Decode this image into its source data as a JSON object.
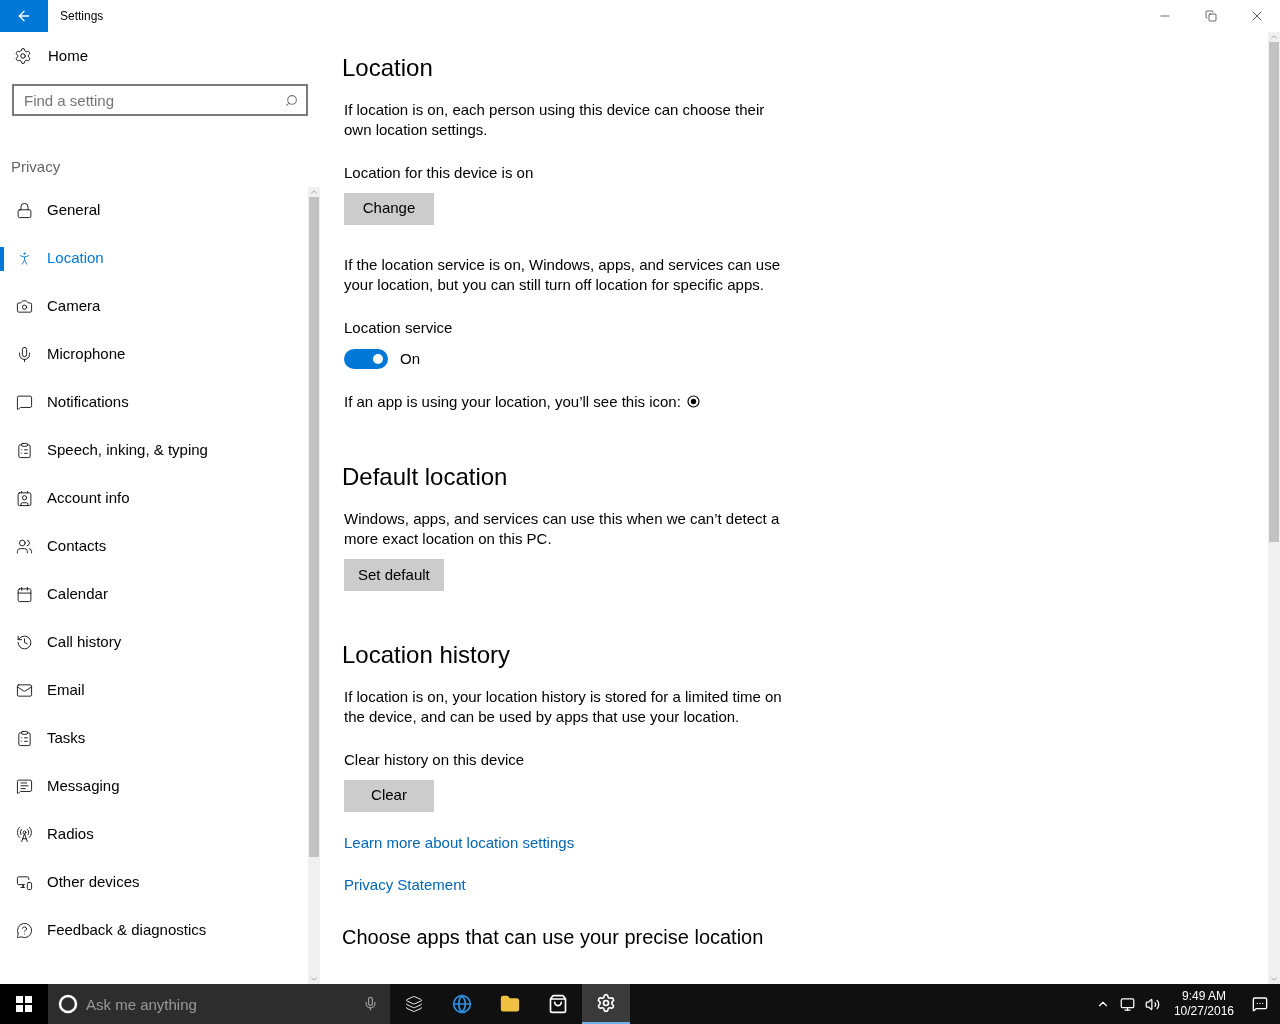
{
  "window": {
    "title": "Settings"
  },
  "sidebar": {
    "home": "Home",
    "search": {
      "placeholder": "Find a setting"
    },
    "section": "Privacy",
    "items": [
      {
        "label": "General",
        "selected": false
      },
      {
        "label": "Location",
        "selected": true
      },
      {
        "label": "Camera",
        "selected": false
      },
      {
        "label": "Microphone",
        "selected": false
      },
      {
        "label": "Notifications",
        "selected": false
      },
      {
        "label": "Speech, inking, & typing",
        "selected": false
      },
      {
        "label": "Account info",
        "selected": false
      },
      {
        "label": "Contacts",
        "selected": false
      },
      {
        "label": "Calendar",
        "selected": false
      },
      {
        "label": "Call history",
        "selected": false
      },
      {
        "label": "Email",
        "selected": false
      },
      {
        "label": "Tasks",
        "selected": false
      },
      {
        "label": "Messaging",
        "selected": false
      },
      {
        "label": "Radios",
        "selected": false
      },
      {
        "label": "Other devices",
        "selected": false
      },
      {
        "label": "Feedback & diagnostics",
        "selected": false
      }
    ]
  },
  "main": {
    "title": "Location",
    "intro": "If location is on, each person using this device can choose their own location settings.",
    "device_status": "Location for this device is on",
    "change_button": "Change",
    "service_text": "If the location service is on, Windows, apps, and services can use your location, but you can still turn off location for specific apps.",
    "service_label": "Location service",
    "service_toggle": {
      "on": true,
      "label": "On"
    },
    "icon_text": "If an app is using your location, you’ll see this icon:",
    "default_title": "Default location",
    "default_text": "Windows, apps, and services can use this when we can’t detect a more exact location on this PC.",
    "default_button": "Set default",
    "history_title": "Location history",
    "history_text": "If location is on, your location history is stored for a limited time on the device, and can be used by apps that use your location.",
    "clear_label": "Clear history on this device",
    "clear_button": "Clear",
    "links": [
      "Learn more about location settings",
      "Privacy Statement"
    ],
    "apps_title": "Choose apps that can use your precise location"
  },
  "taskbar": {
    "search_placeholder": "Ask me anything",
    "time": "9:49 AM",
    "date": "10/27/2016"
  }
}
